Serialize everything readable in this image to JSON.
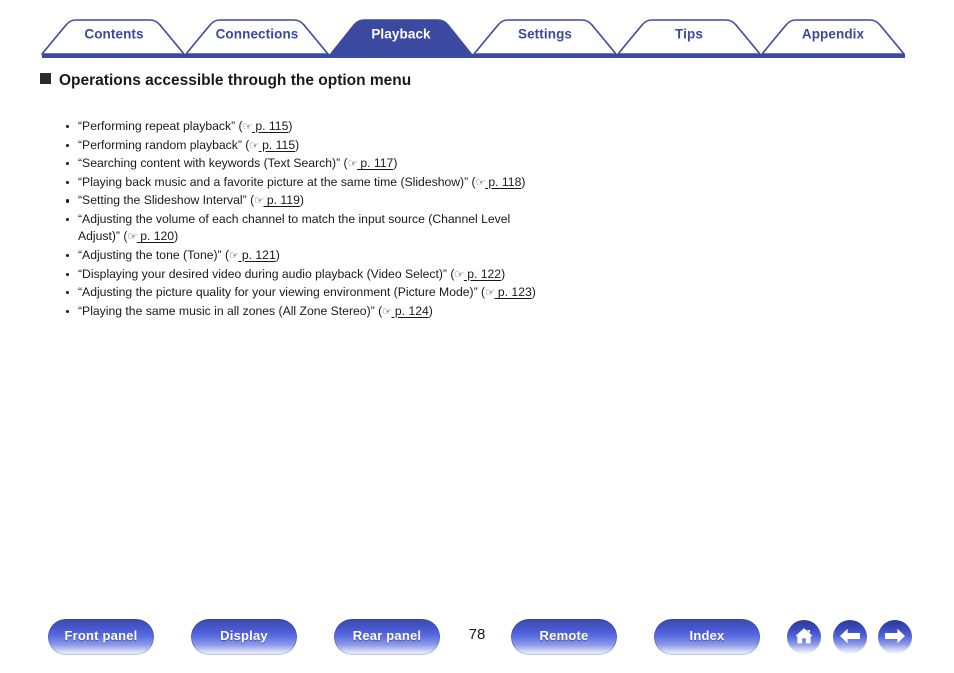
{
  "nav": {
    "tabs": [
      {
        "label": "Contents",
        "active": false
      },
      {
        "label": "Connections",
        "active": false
      },
      {
        "label": "Playback",
        "active": true
      },
      {
        "label": "Settings",
        "active": false
      },
      {
        "label": "Tips",
        "active": false
      },
      {
        "label": "Appendix",
        "active": false
      }
    ],
    "active_color": "#3b4aa0",
    "inactive_text_color": "#3b4aa0",
    "active_text_color": "#ffffff",
    "rule_color": "#3b4aa0"
  },
  "heading": {
    "bullet_glyph": "square",
    "text": "Operations accessible through the option menu"
  },
  "list": {
    "ref_icon": "☞",
    "items": [
      {
        "text": "“Performing repeat playback” (",
        "page": "p. 115",
        "tail": ")"
      },
      {
        "text": "“Performing random playback” (",
        "page": "p. 115",
        "tail": ")"
      },
      {
        "text": "“Searching content with keywords (Text Search)” (",
        "page": "p. 117",
        "tail": ")"
      },
      {
        "text": "“Playing back music and a favorite picture at the same time (Slideshow)” (",
        "page": "p. 118",
        "tail": ")"
      },
      {
        "text": "“Setting the Slideshow Interval” (",
        "page": "p. 119",
        "tail": ")"
      },
      {
        "text": "“Adjusting the volume of each channel to match the input source (Channel Level Adjust)” (",
        "page": "p. 120",
        "tail": ")"
      },
      {
        "text": "“Adjusting the tone (Tone)” (",
        "page": "p. 121",
        "tail": ")"
      },
      {
        "text": "“Displaying your desired video during audio playback (Video Select)” (",
        "page": "p. 122",
        "tail": ")"
      },
      {
        "text": "“Adjusting the picture quality for your viewing environment (Picture Mode)” (",
        "page": "p. 123",
        "tail": ")"
      },
      {
        "text": "“Playing the same music in all zones (All Zone Stereo)” (",
        "page": "p. 124",
        "tail": ")"
      }
    ]
  },
  "footer": {
    "buttons": [
      {
        "label": "Front panel"
      },
      {
        "label": "Display"
      },
      {
        "label": "Rear panel"
      },
      {
        "label": "Remote"
      },
      {
        "label": "Index"
      }
    ],
    "page_number": "78",
    "icons": [
      {
        "name": "home-icon",
        "glyph": "home"
      },
      {
        "name": "back-arrow-icon",
        "glyph": "left"
      },
      {
        "name": "forward-arrow-icon",
        "glyph": "right"
      }
    ],
    "button_color": "#3d4aa8"
  }
}
